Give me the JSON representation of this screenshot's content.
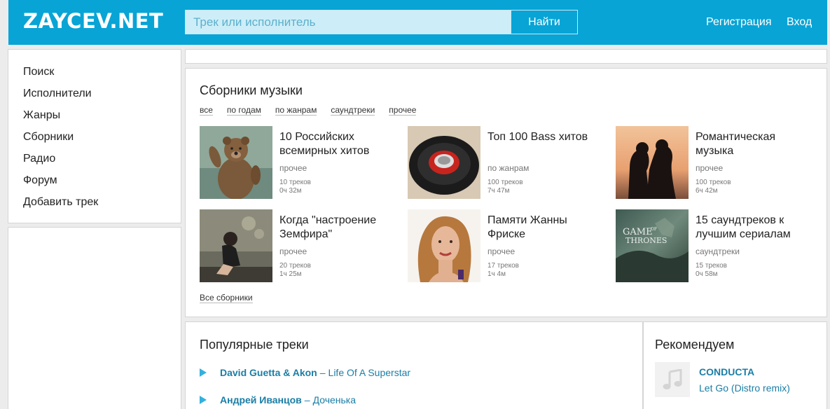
{
  "header": {
    "logo": "ZAYCEV.NET",
    "search_placeholder": "Трек или исполнитель",
    "search_button": "Найти",
    "register": "Регистрация",
    "login": "Вход"
  },
  "sidebar": {
    "items": [
      {
        "label": "Поиск"
      },
      {
        "label": "Исполнители"
      },
      {
        "label": "Жанры"
      },
      {
        "label": "Сборники"
      },
      {
        "label": "Радио"
      },
      {
        "label": "Форум"
      },
      {
        "label": "Добавить трек"
      }
    ]
  },
  "collections": {
    "title": "Сборники музыки",
    "filters": [
      "все",
      "по годам",
      "по жанрам",
      "саундтреки",
      "прочее"
    ],
    "items": [
      {
        "title": "10 Российских всемирных хитов",
        "category": "прочее",
        "tracks": "10 треков",
        "duration": "0ч 32м",
        "image": "bear-photo"
      },
      {
        "title": "Топ 100 Bass хитов",
        "category": "по жанрам",
        "tracks": "100 треков",
        "duration": "7ч 47м",
        "image": "speaker-photo"
      },
      {
        "title": "Романтическая музыка",
        "category": "прочее",
        "tracks": "100 треков",
        "duration": "6ч 42м",
        "image": "couple-silhouette-photo"
      },
      {
        "title": "Когда \"настроение Земфира\"",
        "category": "прочее",
        "tracks": "20 треков",
        "duration": "1ч 25м",
        "image": "girl-sitting-photo"
      },
      {
        "title": "Памяти Жанны Фриске",
        "category": "прочее",
        "tracks": "17 треков",
        "duration": "1ч 4м",
        "image": "woman-portrait-photo"
      },
      {
        "title": "15 саундтреков к лучшим сериалам",
        "category": "саундтреки",
        "tracks": "15 треков",
        "duration": "0ч 58м",
        "image": "game-of-thrones-poster"
      }
    ],
    "thumb_text": {
      "got_line1": "GAME",
      "got_of": "OF",
      "got_line2": "THRONES"
    },
    "all_link": "Все сборники"
  },
  "popular": {
    "title": "Популярные треки",
    "tracks": [
      {
        "artist": "David Guetta & Akon",
        "separator": "–",
        "song": "Life Of A Superstar"
      },
      {
        "artist": "Андрей Иванцов",
        "separator": "–",
        "song": "Доченька"
      }
    ]
  },
  "recommend": {
    "title": "Рекомендуем",
    "artist": "CONDUCTA",
    "song": "Let Go (Distro remix)",
    "icon": "music-note-icon"
  },
  "colors": {
    "brand": "#08a4d6",
    "link": "#1a7ea6",
    "play": "#34b0dd"
  }
}
